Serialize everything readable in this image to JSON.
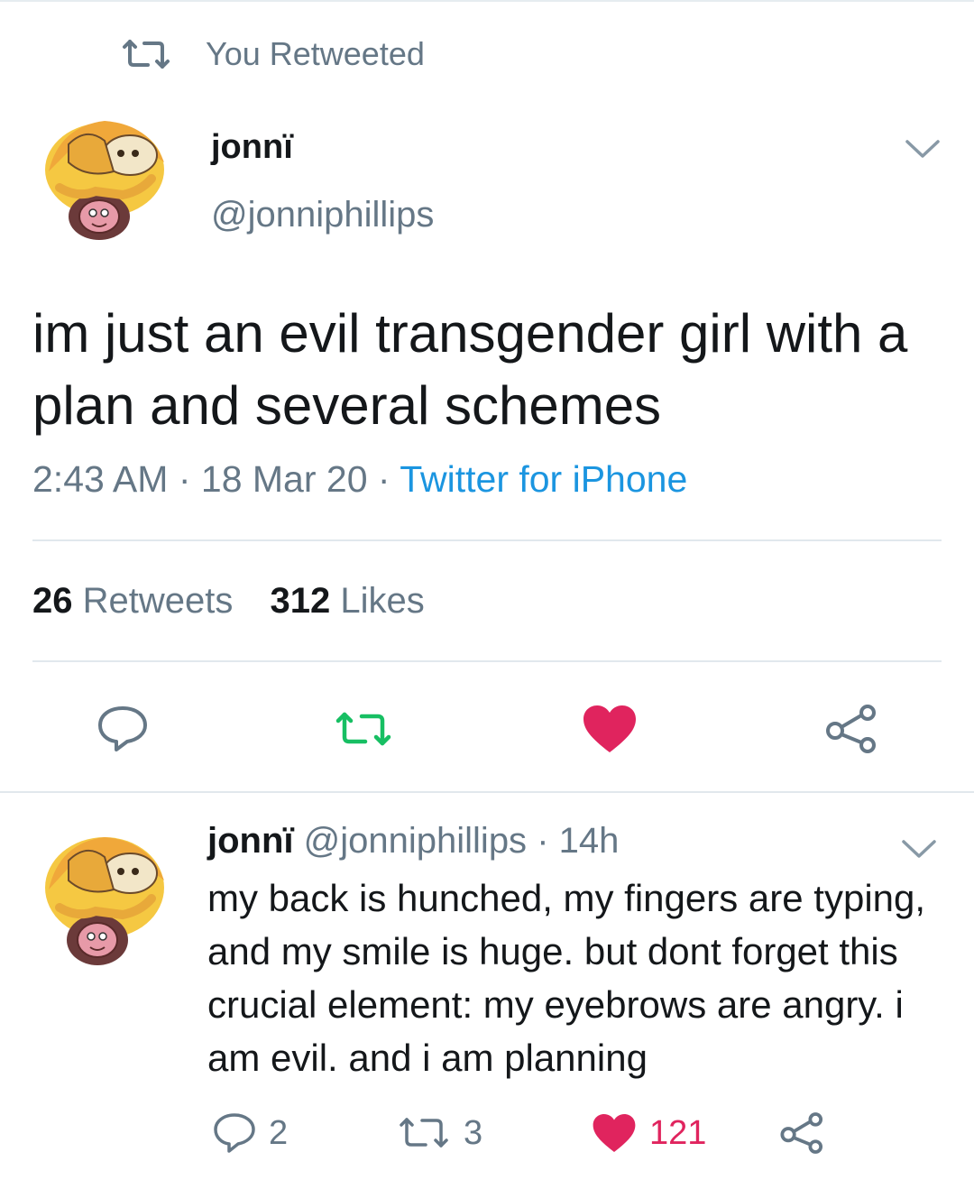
{
  "retweet_context": {
    "label": "You Retweeted"
  },
  "main_tweet": {
    "author_name": "jonnï",
    "author_handle": "@jonniphillips",
    "text": "im just an evil transgender girl with a plan and several schemes",
    "time": "2:43 AM",
    "date": "18 Mar 20",
    "source": "Twitter for iPhone",
    "retweet_count": "26",
    "retweet_label": "Retweets",
    "like_count": "312",
    "like_label": "Likes",
    "liked": true,
    "retweeted": true
  },
  "reply_tweet": {
    "author_name": "jonnï",
    "author_handle": "@jonniphillips",
    "age": "14h",
    "text": "my back is hunched, my fingers are typing, and my smile is huge. but dont forget this crucial element: my eyebrows are angry. i am evil. and i am planning",
    "reply_count": "2",
    "retweet_count": "3",
    "like_count": "121",
    "liked": true
  },
  "colors": {
    "accent_blue": "#1b95e0",
    "like_red": "#e0245e",
    "retweet_green": "#17bf63",
    "secondary_gray": "#657786"
  },
  "icons": {
    "retweet_context": "retweet-icon",
    "caret": "chevron-down-icon",
    "reply": "reply-icon",
    "retweet": "retweet-icon",
    "like": "heart-icon",
    "share": "share-icon"
  },
  "separators": {
    "dot": "·"
  }
}
